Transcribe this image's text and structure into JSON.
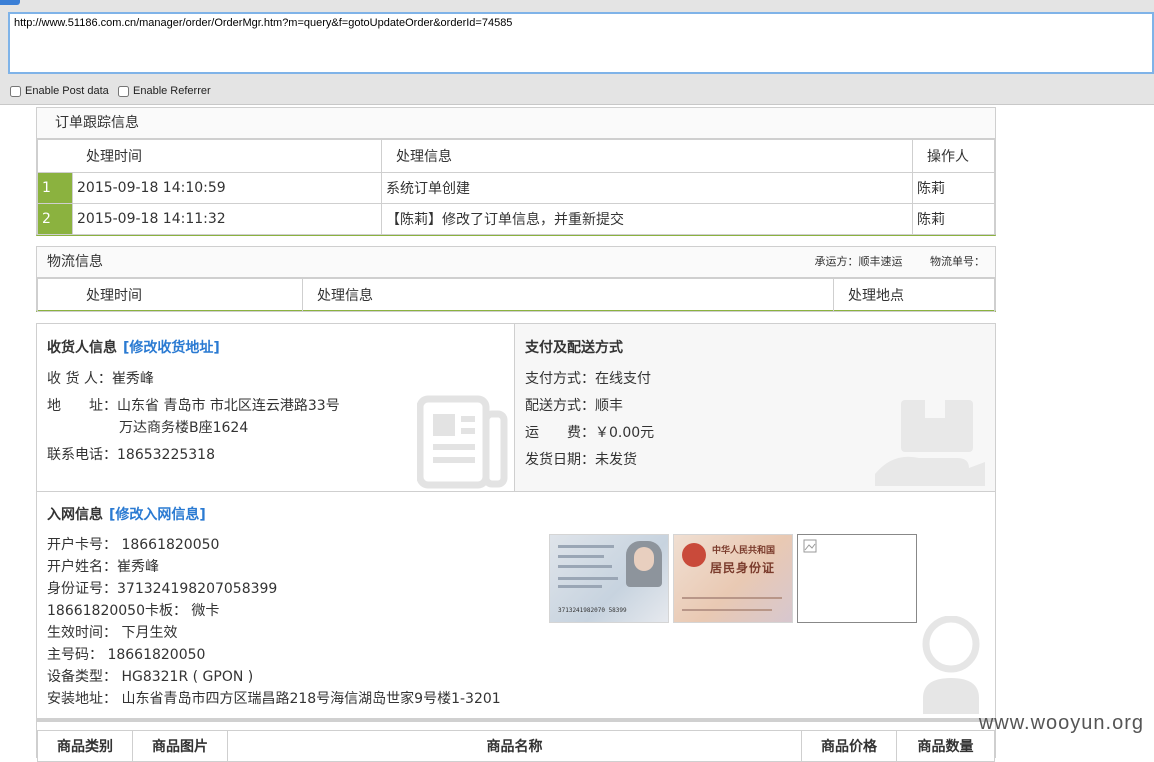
{
  "browser": {
    "url": "http://www.51186.com.cn/manager/order/OrderMgr.htm?m=query&f=gotoUpdateOrder&orderId=74585",
    "enable_post": "Enable Post data",
    "enable_referrer": "Enable Referrer"
  },
  "tracking": {
    "title": "订单跟踪信息",
    "headers": [
      "处理时间",
      "处理信息",
      "操作人"
    ],
    "rows": [
      {
        "n": "1",
        "time": "2015-09-18 14:10:59",
        "info": "系统订单创建",
        "op": "陈莉"
      },
      {
        "n": "2",
        "time": "2015-09-18 14:11:32",
        "info": "【陈莉】修改了订单信息，并重新提交",
        "op": "陈莉"
      }
    ]
  },
  "logistics": {
    "title": "物流信息",
    "carrier": "承运方：顺丰速运",
    "tracking_no": "物流单号：",
    "headers": [
      "处理时间",
      "处理信息",
      "处理地点"
    ]
  },
  "receiver": {
    "title": "收货人信息",
    "edit_link": "[修改收货地址]",
    "name_label": "收 货 人：",
    "name": "崔秀峰",
    "addr_label": "地　　址：",
    "addr1": "山东省 青岛市 市北区连云港路33号",
    "addr2": "万达商务楼B座1624",
    "phone_label": "联系电话：",
    "phone": "18653225318"
  },
  "payment": {
    "title": "支付及配送方式",
    "pay_label": "支付方式：",
    "pay": "在线支付",
    "ship_label": "配送方式：",
    "ship": "顺丰",
    "fee_label": "运　　费：",
    "fee": "￥0.00元",
    "date_label": "发货日期：",
    "date": "未发货"
  },
  "network": {
    "title": "入网信息",
    "edit_link": "[修改入网信息]",
    "lines": [
      "开户卡号： 18661820050",
      "开户姓名：崔秀峰",
      "身份证号：371324198207058399",
      "18661820050卡板： 微卡",
      "生效时间： 下月生效",
      "主号码： 18661820050",
      "设备类型： HG8321R ( GPON )",
      "安装地址： 山东省青岛市四方区瑞昌路218号海信湖岛世家9号楼1-3201"
    ],
    "id_front_text": "3713241982070 58399",
    "id_back_title": "中华人民共和国",
    "id_back_sub": "居民身份证"
  },
  "goods": {
    "headers": [
      "商品类别",
      "商品图片",
      "商品名称",
      "商品价格",
      "商品数量"
    ]
  },
  "watermark": "www.wooyun.org",
  "colors": {
    "accent_green": "#8bb23f",
    "link_blue": "#2a7ad2"
  }
}
